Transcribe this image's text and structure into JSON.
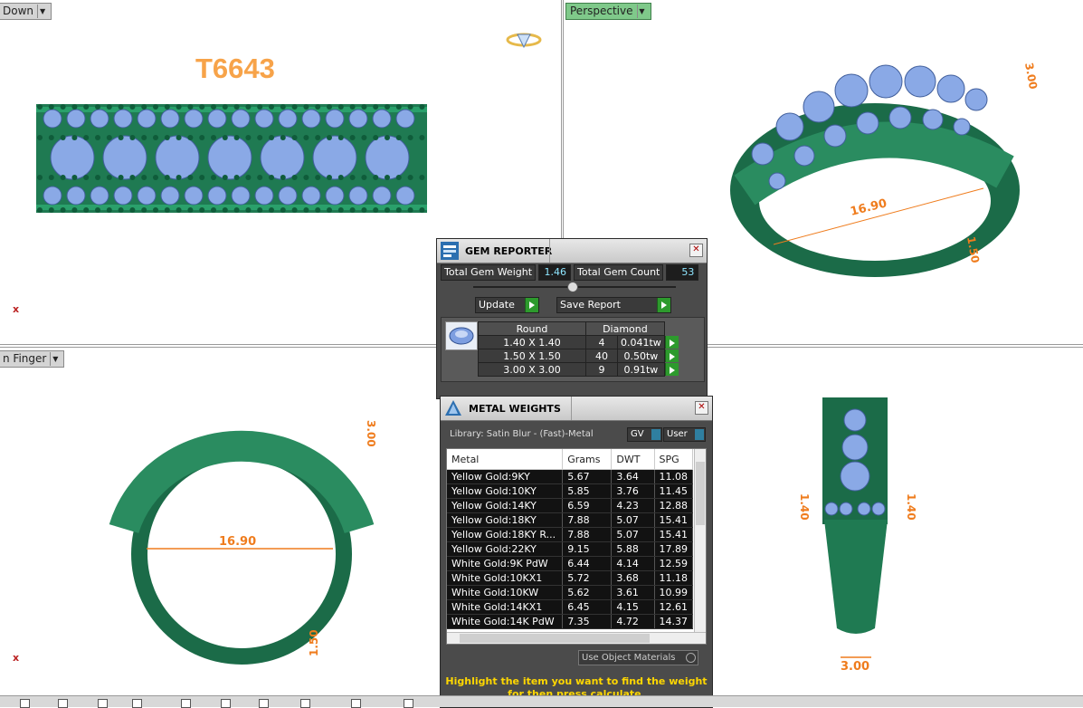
{
  "viewports": {
    "top_left": {
      "label": "Down",
      "model_title": "T6643",
      "axis": "x"
    },
    "top_right": {
      "label": "Perspective",
      "dims": [
        "3.00",
        "16.90",
        "1.50"
      ]
    },
    "bottom_left": {
      "label": "n Finger",
      "axis": "x",
      "dims": [
        "3.00",
        "16.90",
        "1.50"
      ]
    },
    "bottom_right": {
      "dims": [
        "1.40",
        "1.40",
        "3.00"
      ]
    }
  },
  "gem_reporter": {
    "title": "GEM REPORTER",
    "total_weight_label": "Total Gem Weight",
    "total_weight_value": "1.46",
    "total_count_label": "Total Gem Count",
    "total_count_value": "53",
    "update_label": "Update",
    "save_label": "Save Report",
    "header_shape": "Round",
    "header_material": "Diamond",
    "rows": [
      {
        "size": "1.40 X 1.40",
        "count": "4",
        "tw": "0.041tw"
      },
      {
        "size": "1.50 X 1.50",
        "count": "40",
        "tw": "0.50tw"
      },
      {
        "size": "3.00 X 3.00",
        "count": "9",
        "tw": "0.91tw"
      }
    ]
  },
  "metal_weights": {
    "title": "METAL WEIGHTS",
    "library": "Library: Satin Blur - (Fast)-Metal",
    "gv_label": "GV",
    "user_label": "User",
    "columns": [
      "Metal",
      "Grams",
      "DWT",
      "SPG"
    ],
    "rows": [
      [
        "Yellow Gold:9KY",
        "5.67",
        "3.64",
        "11.08"
      ],
      [
        "Yellow Gold:10KY",
        "5.85",
        "3.76",
        "11.45"
      ],
      [
        "Yellow Gold:14KY",
        "6.59",
        "4.23",
        "12.88"
      ],
      [
        "Yellow Gold:18KY",
        "7.88",
        "5.07",
        "15.41"
      ],
      [
        "Yellow Gold:18KY R...",
        "7.88",
        "5.07",
        "15.41"
      ],
      [
        "Yellow Gold:22KY",
        "9.15",
        "5.88",
        "17.89"
      ],
      [
        "White Gold:9K PdW",
        "6.44",
        "4.14",
        "12.59"
      ],
      [
        "White Gold:10KX1",
        "5.72",
        "3.68",
        "11.18"
      ],
      [
        "White Gold:10KW",
        "5.62",
        "3.61",
        "10.99"
      ],
      [
        "White Gold:14KX1",
        "6.45",
        "4.15",
        "12.61"
      ],
      [
        "White Gold:14K PdW",
        "7.35",
        "4.72",
        "14.37"
      ]
    ],
    "use_object_materials": "Use Object Materials",
    "hint_line1": "Highlight the item you want to find the weight",
    "hint_line2": "for then press calculate."
  }
}
